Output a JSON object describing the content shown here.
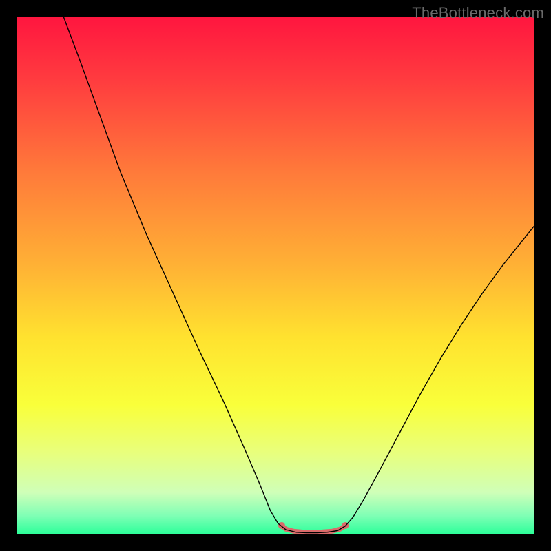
{
  "watermark": "TheBottleneck.com",
  "chart_data": {
    "type": "line",
    "title": "",
    "xlabel": "",
    "ylabel": "",
    "xlim": [
      0,
      100
    ],
    "ylim": [
      0,
      100
    ],
    "background": {
      "gradient_stops": [
        {
          "offset": 0,
          "color": "#ff163f"
        },
        {
          "offset": 12,
          "color": "#ff3b3f"
        },
        {
          "offset": 30,
          "color": "#ff7a3a"
        },
        {
          "offset": 48,
          "color": "#ffb135"
        },
        {
          "offset": 62,
          "color": "#ffe22f"
        },
        {
          "offset": 75,
          "color": "#f9ff3a"
        },
        {
          "offset": 84,
          "color": "#e9ff7a"
        },
        {
          "offset": 92,
          "color": "#cfffb8"
        },
        {
          "offset": 96.5,
          "color": "#7fffb5"
        },
        {
          "offset": 100,
          "color": "#2dff9a"
        }
      ]
    },
    "series": [
      {
        "name": "curve",
        "type": "line",
        "color": "#000000",
        "width": 1.4,
        "points": [
          {
            "x": 9.0,
            "y": 100.0
          },
          {
            "x": 12.0,
            "y": 92.0
          },
          {
            "x": 16.0,
            "y": 81.0
          },
          {
            "x": 20.0,
            "y": 70.0
          },
          {
            "x": 25.0,
            "y": 58.0
          },
          {
            "x": 30.0,
            "y": 47.0
          },
          {
            "x": 35.0,
            "y": 36.0
          },
          {
            "x": 40.0,
            "y": 25.5
          },
          {
            "x": 44.0,
            "y": 16.5
          },
          {
            "x": 47.0,
            "y": 9.5
          },
          {
            "x": 49.0,
            "y": 4.5
          },
          {
            "x": 50.5,
            "y": 2.0
          },
          {
            "x": 52.0,
            "y": 0.8
          },
          {
            "x": 54.0,
            "y": 0.3
          },
          {
            "x": 56.0,
            "y": 0.2
          },
          {
            "x": 58.0,
            "y": 0.2
          },
          {
            "x": 60.0,
            "y": 0.3
          },
          {
            "x": 62.0,
            "y": 0.6
          },
          {
            "x": 63.5,
            "y": 1.5
          },
          {
            "x": 65.0,
            "y": 3.2
          },
          {
            "x": 67.0,
            "y": 6.5
          },
          {
            "x": 70.0,
            "y": 12.0
          },
          {
            "x": 74.0,
            "y": 19.5
          },
          {
            "x": 78.0,
            "y": 27.0
          },
          {
            "x": 82.0,
            "y": 34.0
          },
          {
            "x": 86.0,
            "y": 40.5
          },
          {
            "x": 90.0,
            "y": 46.5
          },
          {
            "x": 94.0,
            "y": 52.0
          },
          {
            "x": 98.0,
            "y": 57.0
          },
          {
            "x": 100.0,
            "y": 59.5
          }
        ]
      },
      {
        "name": "threshold-band",
        "type": "line",
        "color": "#da6a6a",
        "width": 7,
        "points": [
          {
            "x": 51.2,
            "y": 1.6
          },
          {
            "x": 52.0,
            "y": 0.9
          },
          {
            "x": 53.5,
            "y": 0.5
          },
          {
            "x": 55.0,
            "y": 0.35
          },
          {
            "x": 57.0,
            "y": 0.3
          },
          {
            "x": 59.0,
            "y": 0.35
          },
          {
            "x": 61.0,
            "y": 0.5
          },
          {
            "x": 62.5,
            "y": 0.9
          },
          {
            "x": 63.5,
            "y": 1.6
          }
        ]
      }
    ],
    "markers": [
      {
        "name": "threshold-start-dot",
        "x": 51.2,
        "y": 1.6,
        "color": "#da6a6a",
        "r": 5
      },
      {
        "name": "threshold-end-dot",
        "x": 63.5,
        "y": 1.6,
        "color": "#da6a6a",
        "r": 5
      }
    ]
  }
}
